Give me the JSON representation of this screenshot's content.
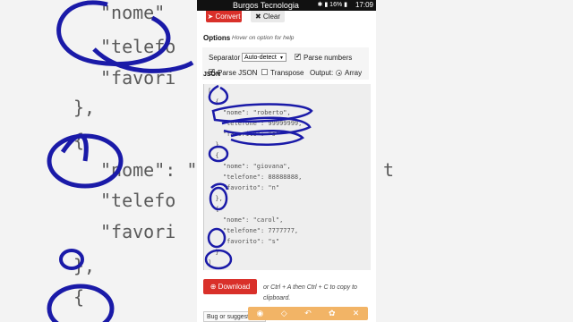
{
  "background": {
    "left_lines": [
      "\"nome\"",
      "\"telefo",
      "\"favori",
      "},",
      "{",
      "\"nome\": \"",
      "\"telefo",
      "\"favori",
      "},",
      "{"
    ],
    "right_fragment": "t"
  },
  "status_bar": {
    "app_title": "Burgos Tecnologia",
    "battery": "16%",
    "time": "17:09"
  },
  "toolbar_top": {
    "convert_label": "Convert",
    "clear_label": "Clear"
  },
  "options": {
    "title": "Options",
    "hint": "Hover on option for help",
    "separator_label": "Separator",
    "separator_value": "Auto-detect",
    "parse_numbers_label": "Parse numbers",
    "parse_json_label": "Parse JSON",
    "transpose_label": "Transpose",
    "output_label": "Output:",
    "output_value": "Array"
  },
  "json_output": {
    "label": "JSON",
    "lines": [
      "[",
      "  {",
      "    \"nome\": \"roberto\",",
      "    \"telefone\": 99999999,",
      "    \"favorito\": \"s\"",
      "  },",
      "  {",
      "    \"nome\": \"giovana\",",
      "    \"telefone\": 88888888,",
      "    \"favorito\": \"n\"",
      "  },",
      "  {",
      "    \"nome\": \"carol\",",
      "    \"telefone\": 7777777,",
      "    \"favorito\": \"s\"",
      "  }",
      "]"
    ]
  },
  "download": {
    "label": "Download",
    "copy_hint": "or Ctrl + A then Ctrl + C to copy to clipboard."
  },
  "bug_link": "Bug or suggestion?",
  "annotation_toolbar": {
    "icons": [
      "camera-icon",
      "eraser-icon",
      "undo-icon",
      "palette-icon",
      "close-icon"
    ],
    "color": "#f2b466"
  },
  "colors": {
    "accent_red": "#d9302a",
    "pen_blue": "#1a1aa8"
  }
}
